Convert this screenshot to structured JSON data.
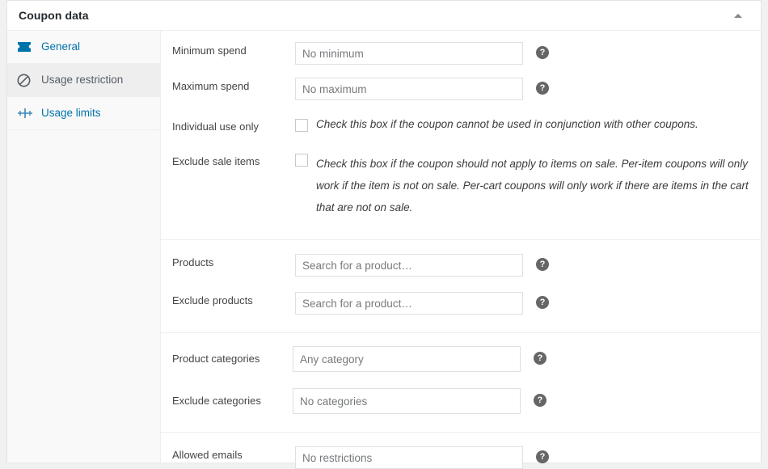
{
  "panel": {
    "title": "Coupon data",
    "collapse_icon": "caret-up-icon"
  },
  "tabs": [
    {
      "id": "general",
      "label": "General",
      "icon": "coupon-ticket-icon",
      "active": false
    },
    {
      "id": "usage-restriction",
      "label": "Usage restriction",
      "icon": "ban-circle-icon",
      "active": true
    },
    {
      "id": "usage-limits",
      "label": "Usage limits",
      "icon": "usage-limits-icon",
      "active": false
    }
  ],
  "help_icon": "help-question-icon",
  "groups": [
    {
      "id": "spend-and-flags",
      "fields": [
        {
          "id": "minimum-spend",
          "type": "text",
          "label": "Minimum spend",
          "value": "",
          "placeholder": "No minimum",
          "help": "?"
        },
        {
          "id": "maximum-spend",
          "type": "text",
          "label": "Maximum spend",
          "value": "",
          "placeholder": "No maximum",
          "help": "?"
        },
        {
          "id": "individual-use-only",
          "type": "checkbox",
          "label": "Individual use only",
          "checked": false,
          "description": "Check this box if the coupon cannot be used in conjunction with other coupons."
        },
        {
          "id": "exclude-sale-items",
          "type": "checkbox",
          "label": "Exclude sale items",
          "checked": false,
          "description": "Check this box if the coupon should not apply to items on sale. Per-item coupons will only work if the item is not on sale. Per-cart coupons will only work if there are items in the cart that are not on sale."
        }
      ]
    },
    {
      "id": "products",
      "fields": [
        {
          "id": "products",
          "type": "text",
          "label": "Products",
          "value": "",
          "placeholder": "Search for a product…",
          "help": "?"
        },
        {
          "id": "exclude-products",
          "type": "text",
          "label": "Exclude products",
          "value": "",
          "placeholder": "Search for a product…",
          "help": "?"
        }
      ]
    },
    {
      "id": "categories",
      "fields": [
        {
          "id": "product-categories",
          "type": "select2",
          "label": "Product categories",
          "placeholder": "Any category",
          "help": "?"
        },
        {
          "id": "exclude-categories",
          "type": "select2",
          "label": "Exclude categories",
          "placeholder": "No categories",
          "help": "?"
        }
      ]
    },
    {
      "id": "emails",
      "fields": [
        {
          "id": "allowed-emails",
          "type": "text",
          "label": "Allowed emails",
          "value": "",
          "placeholder": "No restrictions",
          "help": "?"
        }
      ]
    }
  ],
  "colors": {
    "link_blue": "#0073aa",
    "active_tab_bg": "#eeeeee",
    "page_bg": "#f1f1f1",
    "border": "#eeeeee",
    "label_text": "#444444",
    "placeholder_text": "#76797c"
  }
}
